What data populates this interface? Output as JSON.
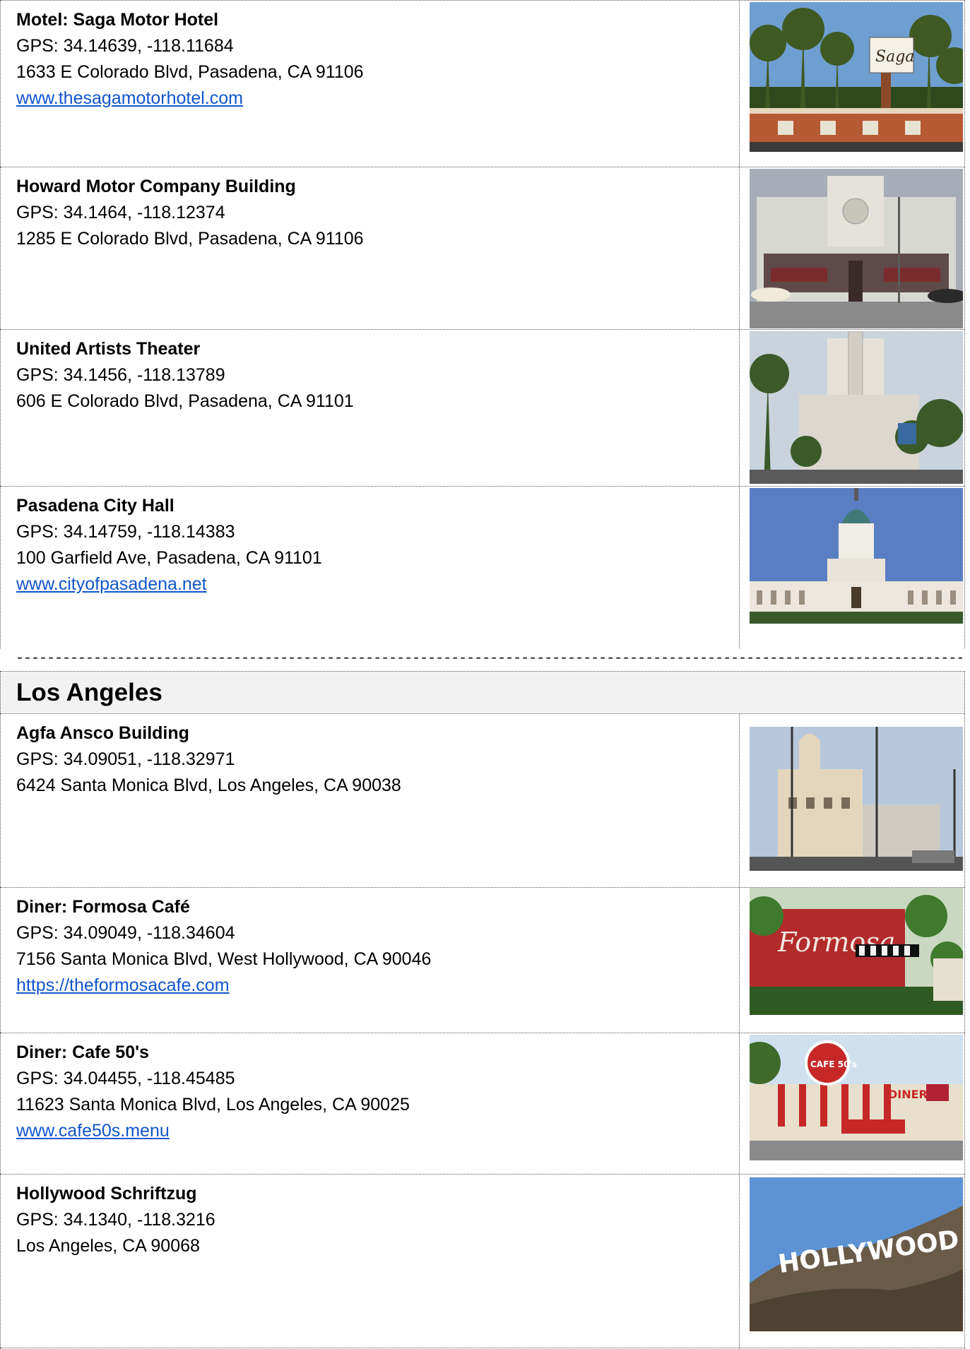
{
  "entries_top": [
    {
      "title": "Motel: Saga Motor Hotel",
      "gps": "GPS: 34.14639, -118.11684",
      "address": "1633 E Colorado Blvd, Pasadena, CA 91106",
      "link": "www.thesagamotorhotel.com",
      "photo": "saga-motor-hotel-photo"
    },
    {
      "title": "Howard Motor Company Building",
      "gps": "GPS: 34.1464, -118.12374",
      "address": "1285 E Colorado Blvd, Pasadena, CA 91106",
      "link": "",
      "photo": "howard-motor-building-photo"
    },
    {
      "title": "United Artists Theater",
      "gps": "GPS: 34.1456, -118.13789",
      "address": "606 E Colorado Blvd, Pasadena, CA 91101",
      "link": "",
      "photo": "united-artists-theater-photo"
    },
    {
      "title": "Pasadena City Hall",
      "gps": "GPS: 34.14759, -118.14383",
      "address": "100 Garfield Ave, Pasadena, CA 91101",
      "link": "www.cityofpasadena.net",
      "photo": "pasadena-city-hall-photo"
    }
  ],
  "separator": "--------------------------------------------------------------------------------------------------------------------------",
  "section_title": "Los Angeles",
  "entries_la": [
    {
      "title": "Agfa Ansco Building",
      "gps": "GPS: 34.09051, -118.32971",
      "address": "6424 Santa Monica Blvd, Los Angeles, CA 90038",
      "link": "",
      "photo": "agfa-ansco-building-photo"
    },
    {
      "title": "Diner: Formosa Café",
      "gps": "GPS: 34.09049, -118.34604",
      "address": "7156 Santa Monica Blvd, West Hollywood, CA 90046",
      "link": "https://theformosacafe.com",
      "photo": "formosa-cafe-photo"
    },
    {
      "title": "Diner: Cafe 50's",
      "gps": "GPS: 34.04455, -118.45485",
      "address": "11623 Santa Monica Blvd, Los Angeles, CA 90025",
      "link": "www.cafe50s.menu",
      "photo": "cafe-50s-photo"
    },
    {
      "title": "Hollywood Schriftzug",
      "gps": "GPS: 34.1340, -118.3216",
      "address": "Los Angeles, CA 90068",
      "link": "",
      "photo": "hollywood-sign-photo"
    }
  ],
  "photo_text": {
    "saga_sign": "Saga",
    "hollywood": "HOLLYWOOD",
    "formosa": "Formosa",
    "cafe50": "CAFE 50's",
    "diner": "DINER"
  }
}
